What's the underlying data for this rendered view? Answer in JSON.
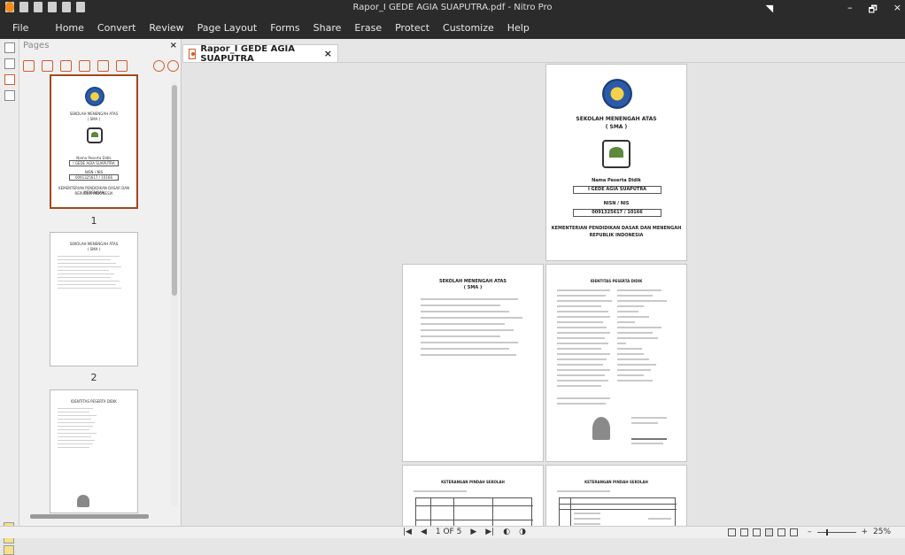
{
  "titlebar": {
    "title": "Rapor_I GEDE AGIA SUAPUTRA.pdf - Nitro Pro",
    "minimize": "–",
    "maximize": "🗗",
    "close": "×"
  },
  "menu": [
    "File",
    "Home",
    "Convert",
    "Review",
    "Page Layout",
    "Forms",
    "Share",
    "Erase",
    "Protect",
    "Customize",
    "Help"
  ],
  "pages_panel": {
    "title": "Pages",
    "close": "×",
    "thumb_labels": [
      "1",
      "2"
    ]
  },
  "document_tab": {
    "label": "Rapor_I GEDE AGIA SUAPUTRA",
    "close": "×"
  },
  "cover_page": {
    "school_title_line1": "SEKOLAH MENENGAH ATAS",
    "school_title_line2": "( SMA )",
    "student_name_label": "Nama Peserta Didik",
    "student_name": "I GEDE AGIA SUAPUTRA",
    "nisn_label": "NISN / NIS",
    "nisn": "0091325617 / 10166",
    "ministry_line1": "KEMENTERIAN PENDIDIKAN DASAR DAN MENENGAH",
    "ministry_line2": "REPUBLIK INDONESIA"
  },
  "page2": {
    "title": "SEKOLAH MENENGAH ATAS",
    "subtitle": "( SMA )"
  },
  "page3": {
    "title": "IDENTITAS PESERTA DIDIK"
  },
  "page4": {
    "title": "KETERANGAN PINDAH SEKOLAH"
  },
  "page5": {
    "title": "KETERANGAN PINDAH SEKOLAH"
  },
  "statusbar": {
    "page_indicator": "1 OF 5",
    "zoom": "25%",
    "zoom_minus": "–",
    "zoom_plus": "+"
  }
}
